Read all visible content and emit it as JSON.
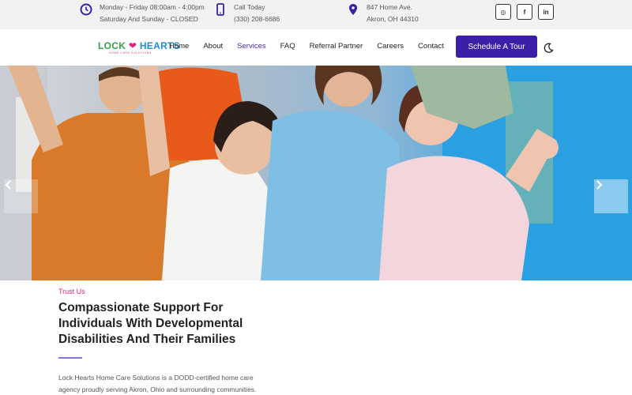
{
  "topbar": {
    "hours": {
      "icon": "clock-icon",
      "line1": "Monday - Friday 08:00am - 4:00pm",
      "line2": "Saturday And Sunday - CLOSED"
    },
    "phone": {
      "icon": "phone-icon",
      "line1": "Call Today",
      "line2": "(330) 208-6686"
    },
    "address": {
      "icon": "map-pin-icon",
      "line1": "847 Home Ave.",
      "line2": "Akron, OH 44310"
    },
    "social": [
      {
        "icon": "instagram-icon",
        "label": "◎"
      },
      {
        "icon": "facebook-icon",
        "label": "f"
      },
      {
        "icon": "linkedin-icon",
        "label": "in"
      }
    ]
  },
  "nav": {
    "logo": {
      "lock": "LOCK",
      "hearts": "HEARTS",
      "tagline": "HOME CARE SOLUTIONS"
    },
    "items": [
      "Home",
      "About",
      "Services",
      "FAQ",
      "Referral Partner",
      "Careers",
      "Contact"
    ],
    "active": "Services",
    "cta": "Schedule A Tour",
    "theme_toggle_icon": "moon-icon"
  },
  "hero": {
    "image": "group-of-smiling-people-photo",
    "prev_icon": "chevron-left-icon",
    "next_icon": "chevron-right-icon"
  },
  "section": {
    "kicker": "Trust Us",
    "heading": "Compassionate Support For Individuals With Developmental Disabilities And Their Families",
    "paragraph": "Lock Hearts Home Care Solutions is a DODD-certified home care agency proudly serving Akron, Ohio and surrounding communities."
  },
  "colors": {
    "accent": "#3c1fa8",
    "kicker": "#e0257a",
    "active_link": "#4a2bb0"
  }
}
